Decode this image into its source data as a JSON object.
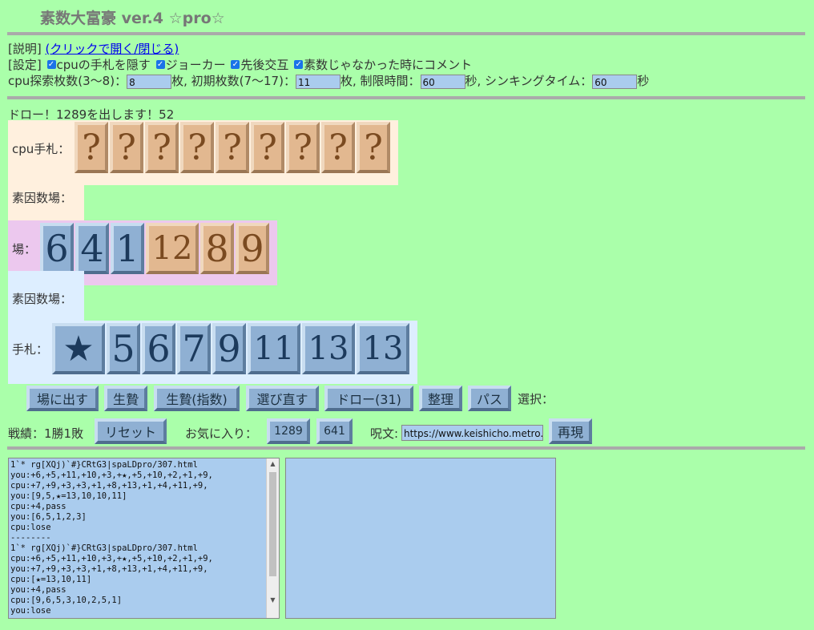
{
  "header": {
    "title": "素数大富豪 ver.4 ☆pro☆"
  },
  "explain": {
    "label": "[説明]",
    "link": "(クリックで開く/閉じる)"
  },
  "settings": {
    "label": "[設定]",
    "options": [
      "cpuの手札を隠す",
      "ジョーカー",
      "先後交互",
      "素数じゃなかった時にコメント"
    ]
  },
  "params": {
    "search_label": "cpu探索枚数(3～8)：",
    "search_value": "8",
    "init_label": "枚, 初期枚数(7～17)：",
    "init_value": "11",
    "limit_label": "枚, 制限時間：",
    "limit_value": "60",
    "think_label": "秒, シンキングタイム：",
    "think_value": "60",
    "sec_label": "秒"
  },
  "status_message": "ドロー！1289を出します！52",
  "cpu_hand": {
    "label": "cpu手札：",
    "cards": [
      "?",
      "?",
      "?",
      "?",
      "?",
      "?",
      "?",
      "?",
      "?"
    ]
  },
  "cpu_factor": {
    "label": "素因数場："
  },
  "field": {
    "label": "場：",
    "cards": [
      {
        "value": "6",
        "color": "blue"
      },
      {
        "value": "4",
        "color": "blue"
      },
      {
        "value": "1",
        "color": "blue"
      },
      {
        "value": "12",
        "color": "orange"
      },
      {
        "value": "8",
        "color": "orange"
      },
      {
        "value": "9",
        "color": "orange"
      }
    ]
  },
  "player_factor": {
    "label": "素因数場："
  },
  "player_hand": {
    "label": "手札：",
    "cards": [
      "★",
      "5",
      "6",
      "7",
      "9",
      "11",
      "13",
      "13"
    ]
  },
  "actions": [
    "場に出す",
    "生贄",
    "生贄(指数)",
    "選び直す",
    "ドロー(31)",
    "整理",
    "パス"
  ],
  "selection_label": "選択：",
  "record": {
    "label": "戦績：1勝1敗",
    "reset": "リセット",
    "fav_label": "お気に入り：",
    "fav": [
      "1289",
      "641"
    ],
    "spell_label": "呪文:",
    "spell_value": "https://www.keishicho.metro.",
    "replay": "再現"
  },
  "log": "1`* rg[XQj)`#}CRtG3|spaLDpro/307.html\nyou:+6,+5,+11,+10,+3,+★,+5,+10,+2,+1,+9,\ncpu:+7,+9,+3,+3,+1,+8,+13,+1,+4,+11,+9,\nyou:[9,5,★=13,10,10,11]\ncpu:+4,pass\nyou:[6,5,1,2,3]\ncpu:lose\n--------\n1`* rg[XQj)`#}CRtG3|spaLDpro/307.html\ncpu:+6,+5,+11,+10,+3,+★,+5,+10,+2,+1,+9,\nyou:+7,+9,+3,+3,+1,+8,+13,+1,+4,+11,+9,\ncpu:[★=13,10,11]\nyou:+4,pass\ncpu:[9,6,5,3,10,2,5,1]\nyou:lose",
  "colors": {
    "background": "#aaffaa",
    "card_blue": "#8fb0d3",
    "card_orange": "#e2b890"
  }
}
